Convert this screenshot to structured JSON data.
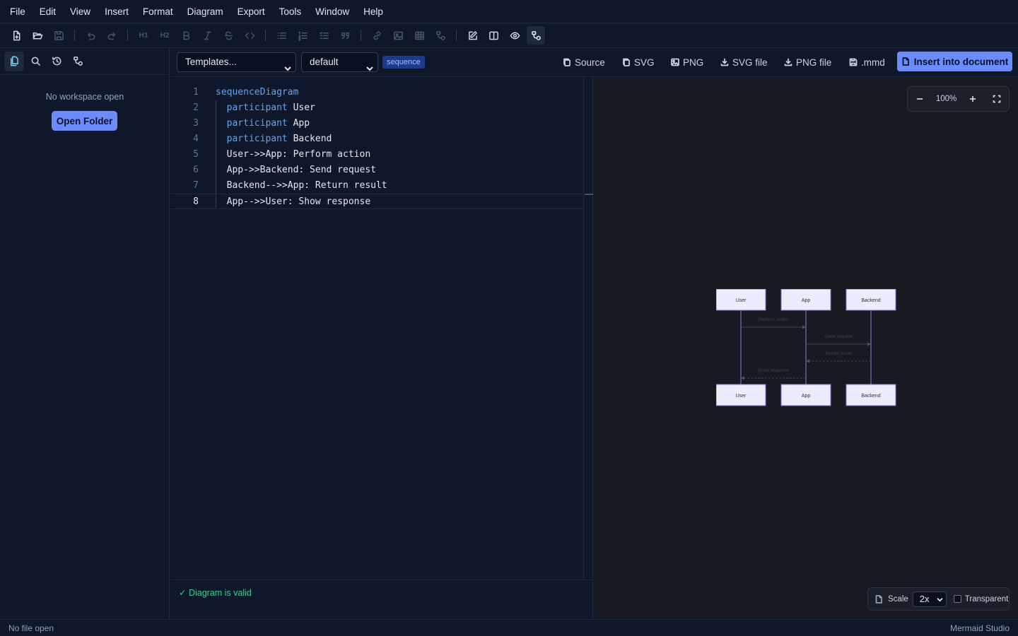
{
  "menu": [
    "File",
    "Edit",
    "View",
    "Insert",
    "Format",
    "Diagram",
    "Export",
    "Tools",
    "Window",
    "Help"
  ],
  "toolbar": {
    "h1": "H1",
    "h2": "H2"
  },
  "sidebar": {
    "empty_text": "No workspace open",
    "open_folder_label": "Open Folder"
  },
  "editor_header": {
    "template_select": "Templates...",
    "theme_select": "default",
    "diagram_type": "sequence",
    "buttons": {
      "source": "Source",
      "svg": "SVG",
      "png": "PNG",
      "svg_file": "SVG file",
      "png_file": "PNG file",
      "mmd": ".mmd",
      "insert": "Insert into document"
    }
  },
  "editor": {
    "current_line": 8,
    "lines": [
      {
        "num": "1",
        "kw": "sequenceDiagram",
        "rest": ""
      },
      {
        "num": "2",
        "kw": "  participant",
        "rest": " User"
      },
      {
        "num": "3",
        "kw": "  participant",
        "rest": " App"
      },
      {
        "num": "4",
        "kw": "  participant",
        "rest": " Backend"
      },
      {
        "num": "5",
        "kw": "",
        "rest": "  User->>App: Perform action"
      },
      {
        "num": "6",
        "kw": "",
        "rest": "  App->>Backend: Send request"
      },
      {
        "num": "7",
        "kw": "",
        "rest": "  Backend-->>App: Return result"
      },
      {
        "num": "8",
        "kw": "",
        "rest": "  App-->>User: Show response"
      }
    ],
    "status": "✓ Diagram is valid"
  },
  "preview": {
    "zoom": "100%",
    "scale_label": "Scale",
    "scale_value": "2x",
    "transparent_label": "Transparent",
    "transparent_checked": false,
    "diagram": {
      "participants": [
        "User",
        "App",
        "Backend"
      ],
      "messages": [
        {
          "from": "User",
          "to": "App",
          "text": "Perform action",
          "dashed": false
        },
        {
          "from": "App",
          "to": "Backend",
          "text": "Send request",
          "dashed": false
        },
        {
          "from": "Backend",
          "to": "App",
          "text": "Return result",
          "dashed": true
        },
        {
          "from": "App",
          "to": "User",
          "text": "Show response",
          "dashed": true
        }
      ]
    }
  },
  "footer": {
    "left": "No file open",
    "right": "Mermaid Studio"
  }
}
